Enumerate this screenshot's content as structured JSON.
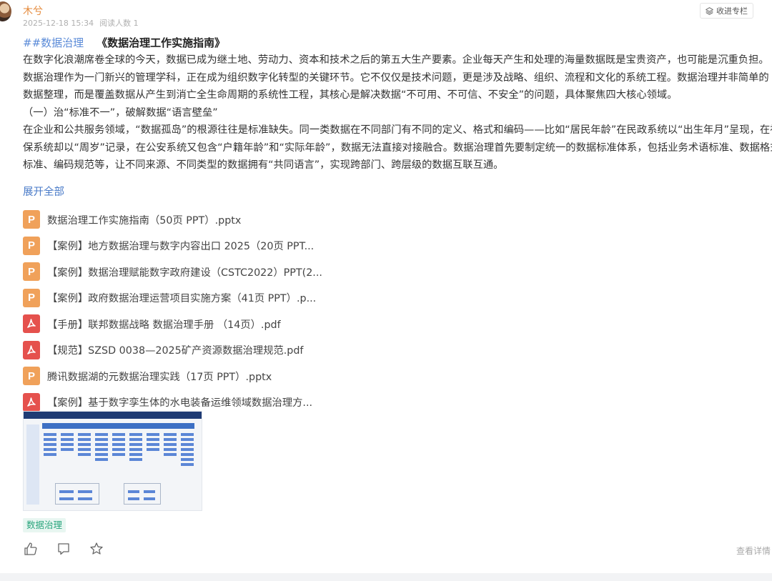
{
  "post": {
    "author": "木兮",
    "date": "2025-12-18 15:34",
    "readers": "阅读人数 1",
    "collect_label": "收进专栏",
    "hashtag": "##数据治理",
    "title": "《数据治理工作实施指南》",
    "paragraphs": [
      "在数字化浪潮席卷全球的今天，数据已成为继土地、劳动力、资本和技术之后的第五大生产要素。企业每天产生和处理的海量数据既是宝贵资产，也可能是沉重负担。",
      "数据治理作为一门新兴的管理学科，正在成为组织数字化转型的关键环节。它不仅仅是技术问题，更是涉及战略、组织、流程和文化的系统工程。数据治理并非简单的",
      "数据整理，而是覆盖数据从产生到消亡全生命周期的系统性工程，其核心是解决数据“不可用、不可信、不安全”的问题，具体聚焦四大核心领域。",
      "（一）治“标准不一”，破解数据“语言壁垒”",
      "在企业和公共服务领域，“数据孤岛”的根源往往是标准缺失。同一类数据在不同部门有不同的定义、格式和编码——比如“居民年龄”在民政系统以“出生年月”呈现，在社",
      "保系统却以“周岁”记录，在公安系统又包含“户籍年龄”和“实际年龄”，数据无法直接对接融合。数据治理首先要制定统一的数据标准体系，包括业务术语标准、数据格式",
      "标准、编码规范等，让不同来源、不同类型的数据拥有“共同语言”，实现跨部门、跨层级的数据互联互通。"
    ],
    "expand_label": "展开全部",
    "files": [
      {
        "type": "ppt",
        "name": "数据治理工作实施指南（50页 PPT）.pptx"
      },
      {
        "type": "ppt",
        "name": "【案例】地方数据治理与数字内容出口 2025（20页 PPT..."
      },
      {
        "type": "ppt",
        "name": "【案例】数据治理赋能数字政府建设（CSTC2022）PPT(2..."
      },
      {
        "type": "ppt",
        "name": "【案例】政府数据治理运营项目实施方案（41页 PPT）.p..."
      },
      {
        "type": "pdf",
        "name": "【手册】联邦数据战略 数据治理手册 （14页）.pdf"
      },
      {
        "type": "pdf",
        "name": "【规范】SZSD 0038—2025矿产资源数据治理规范.pdf"
      },
      {
        "type": "ppt",
        "name": "腾讯数据湖的元数据治理实践（17页 PPT）.pptx"
      },
      {
        "type": "pdf",
        "name": "【案例】基于数字孪生体的水电装备运维领域数据治理方..."
      }
    ],
    "tag": "数据治理",
    "detail_label": "查看详情"
  },
  "icons": {
    "ppt_icon": "P",
    "pdf_icon": "pdf-icon",
    "like": "thumbs-up-icon",
    "comment": "comment-icon",
    "favorite": "star-icon",
    "collect": "layers-icon"
  },
  "colors": {
    "author": "#e58a3b",
    "link": "#4a7bc8",
    "ppt": "#f0a15a",
    "pdf": "#e5514d",
    "tag_bg": "#e8f6f1",
    "tag_text": "#2aa57d"
  }
}
